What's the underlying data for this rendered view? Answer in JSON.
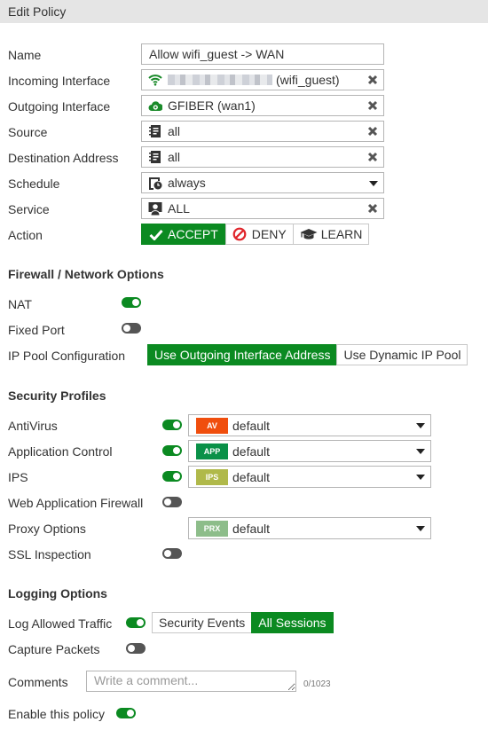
{
  "header": {
    "title": "Edit Policy"
  },
  "form": {
    "name": {
      "label": "Name",
      "value": "Allow wifi_guest -> WAN"
    },
    "incoming_interface": {
      "label": "Incoming Interface",
      "value": "(wifi_guest)",
      "icon": "wifi-icon",
      "redacted": true
    },
    "outgoing_interface": {
      "label": "Outgoing Interface",
      "value": "GFIBER (wan1)",
      "icon": "wan-cloud-icon"
    },
    "source": {
      "label": "Source",
      "value": "all",
      "icon": "address-book-icon"
    },
    "destination": {
      "label": "Destination Address",
      "value": "all",
      "icon": "address-book-icon"
    },
    "schedule": {
      "label": "Schedule",
      "value": "always",
      "icon": "schedule-clock-icon"
    },
    "service": {
      "label": "Service",
      "value": "ALL",
      "icon": "service-icon"
    },
    "action": {
      "label": "Action",
      "options": [
        {
          "label": "ACCEPT",
          "icon": "check-icon",
          "selected": true
        },
        {
          "label": "DENY",
          "icon": "deny-icon",
          "selected": false
        },
        {
          "label": "LEARN",
          "icon": "graduation-cap-icon",
          "selected": false
        }
      ]
    }
  },
  "firewall": {
    "title": "Firewall / Network Options",
    "nat": {
      "label": "NAT",
      "enabled": true
    },
    "fixed_port": {
      "label": "Fixed Port",
      "enabled": false
    },
    "ip_pool": {
      "label": "IP Pool Configuration",
      "options": [
        {
          "label": "Use Outgoing Interface Address",
          "selected": true
        },
        {
          "label": "Use Dynamic IP Pool",
          "selected": false
        }
      ]
    }
  },
  "security": {
    "title": "Security Profiles",
    "antivirus": {
      "label": "AntiVirus",
      "enabled": true,
      "badge": "AV",
      "badge_color": "#f04e0d",
      "value": "default"
    },
    "app_control": {
      "label": "Application Control",
      "enabled": true,
      "badge": "APP",
      "badge_color": "#0a9148",
      "value": "default"
    },
    "ips": {
      "label": "IPS",
      "enabled": true,
      "badge": "IPS",
      "badge_color": "#b0b94a",
      "value": "default"
    },
    "waf": {
      "label": "Web Application Firewall",
      "enabled": false
    },
    "proxy": {
      "label": "Proxy Options",
      "badge": "PRX",
      "badge_color": "#8dbd8a",
      "value": "default"
    },
    "ssl": {
      "label": "SSL Inspection",
      "enabled": false
    }
  },
  "logging": {
    "title": "Logging Options",
    "log_allowed": {
      "label": "Log Allowed Traffic",
      "enabled": true,
      "options": [
        {
          "label": "Security Events",
          "selected": false
        },
        {
          "label": "All Sessions",
          "selected": true
        }
      ]
    },
    "capture": {
      "label": "Capture Packets",
      "enabled": false
    }
  },
  "comments": {
    "label": "Comments",
    "placeholder": "Write a comment...",
    "counter": "0/1023"
  },
  "enable_policy": {
    "label": "Enable this policy",
    "enabled": true
  },
  "colors": {
    "accent": "#0b8a21",
    "toggle_off": "#555555",
    "header_bg": "#e5e5e5"
  }
}
